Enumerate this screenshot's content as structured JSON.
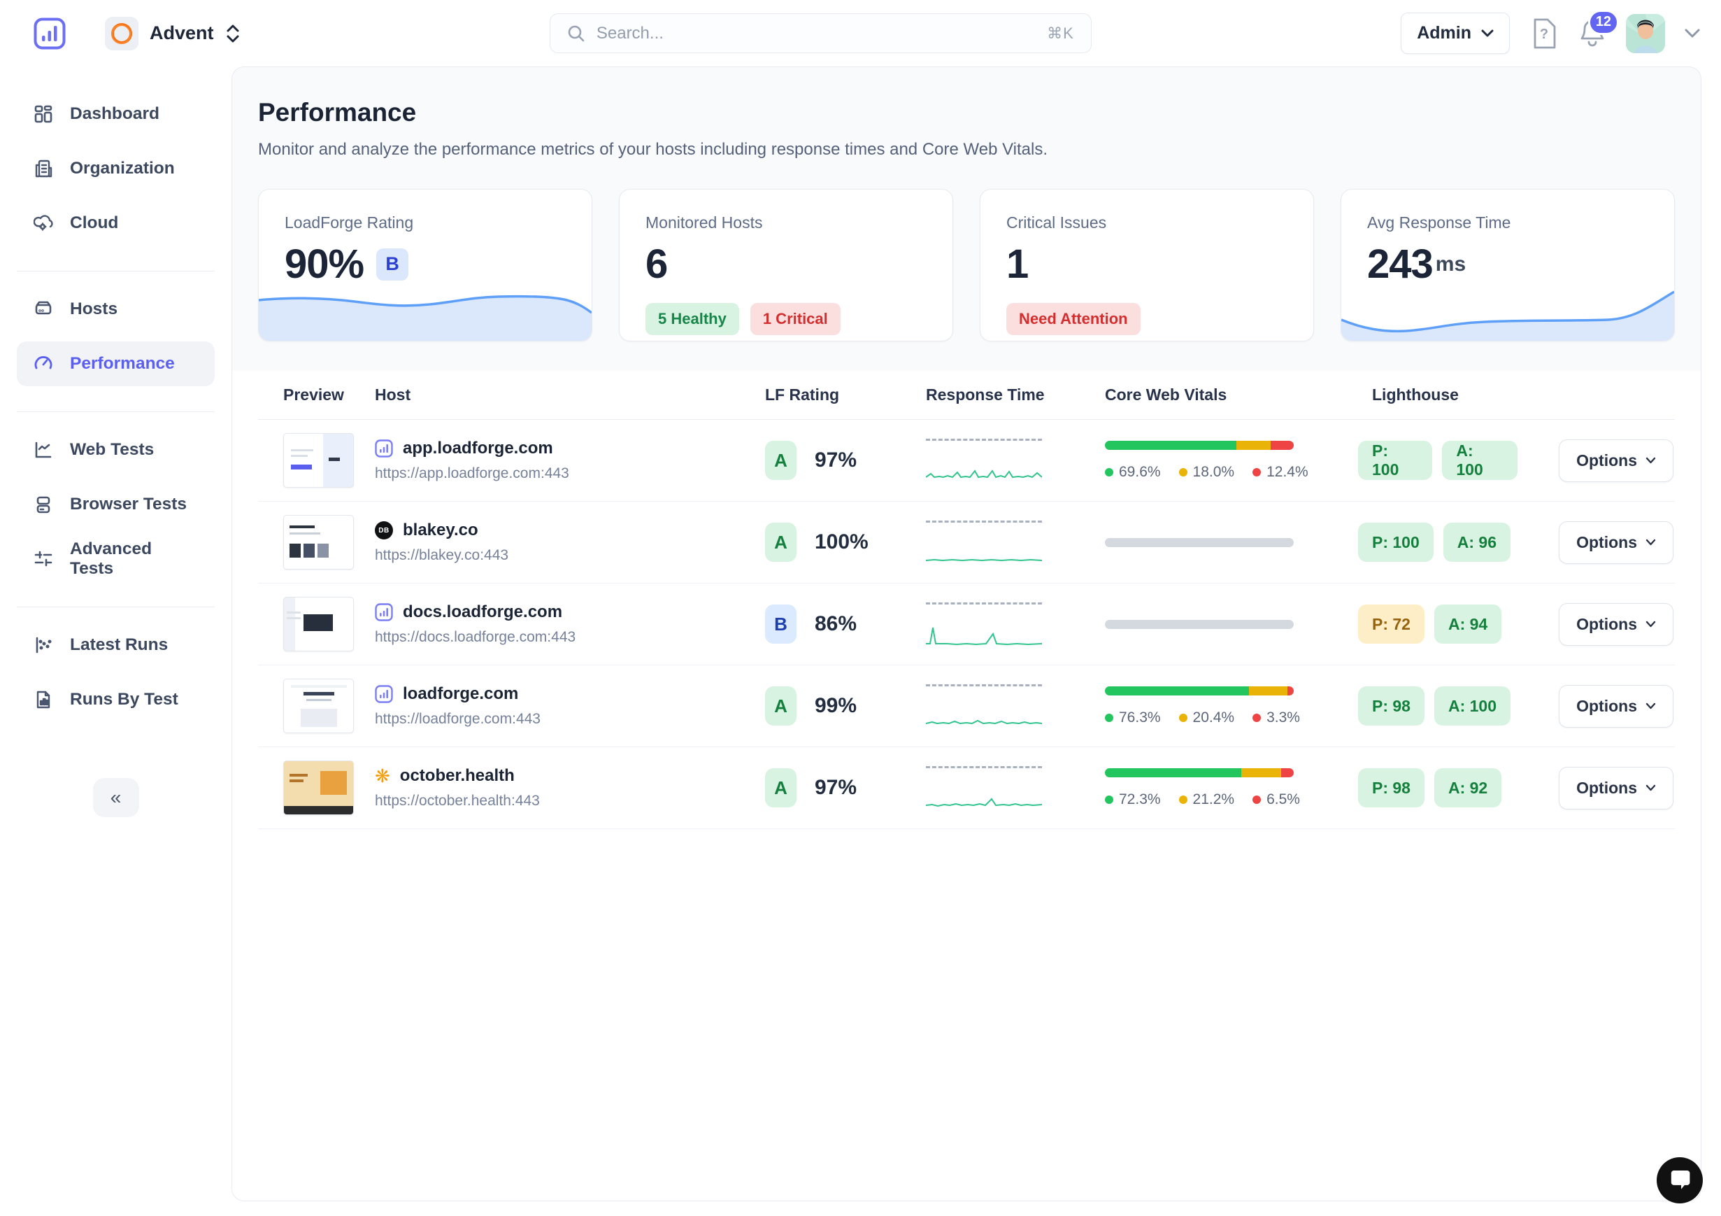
{
  "header": {
    "org": {
      "name": "Advent"
    },
    "search": {
      "placeholder": "Search...",
      "shortcut": "⌘K"
    },
    "role": {
      "label": "Admin"
    },
    "notifications": {
      "count": "12"
    },
    "icons": {
      "logo": "bar-chart",
      "search": "magnifier",
      "help": "question-file",
      "notifications": "bell",
      "org_switcher": "chevron-up-down",
      "user_menu": "chevron-down"
    }
  },
  "sidebar": {
    "sections": [
      {
        "items": [
          {
            "label": "Dashboard",
            "icon": "grid"
          },
          {
            "label": "Organization",
            "icon": "building"
          },
          {
            "label": "Cloud",
            "icon": "cloud-gear"
          }
        ]
      },
      {
        "items": [
          {
            "label": "Hosts",
            "icon": "server"
          },
          {
            "label": "Performance",
            "icon": "gauge",
            "active": true
          }
        ]
      },
      {
        "items": [
          {
            "label": "Web Tests",
            "icon": "line-chart"
          },
          {
            "label": "Browser Tests",
            "icon": "browser-stack"
          },
          {
            "label": "Advanced Tests",
            "icon": "sliders"
          }
        ]
      },
      {
        "items": [
          {
            "label": "Latest Runs",
            "icon": "scatter-chart"
          },
          {
            "label": "Runs By Test",
            "icon": "report-doc"
          }
        ]
      }
    ],
    "collapse": "«"
  },
  "page": {
    "title": "Performance",
    "subtitle": "Monitor and analyze the performance metrics of your hosts including response times and Core Web Vitals."
  },
  "stats": {
    "rating": {
      "label": "LoadForge Rating",
      "value": "90%",
      "grade": "B"
    },
    "hosts": {
      "label": "Monitored Hosts",
      "value": "6",
      "healthy": "5 Healthy",
      "critical": "1 Critical"
    },
    "issues": {
      "label": "Critical Issues",
      "value": "1",
      "badge": "Need Attention"
    },
    "response": {
      "label": "Avg Response Time",
      "value": "243",
      "unit": "ms"
    }
  },
  "table": {
    "columns": {
      "preview": "Preview",
      "host": "Host",
      "rating": "LF Rating",
      "response": "Response Time",
      "vitals": "Core Web Vitals",
      "lighthouse": "Lighthouse"
    },
    "options_label": "Options",
    "rows": [
      {
        "host": "app.loadforge.com",
        "url": "https://app.loadforge.com:443",
        "favicon": "loadforge-chart-icon",
        "grade": "A",
        "grade_tone": "green",
        "rating": "97%",
        "vitals": {
          "good": "69.6%",
          "needs_improvement": "18.0%",
          "poor": "12.4%"
        },
        "lighthouse": {
          "p": "P: 100",
          "p_tone": "green",
          "a": "A: 100",
          "a_tone": "green"
        }
      },
      {
        "host": "blakey.co",
        "url": "https://blakey.co:443",
        "favicon": "db-circle-icon",
        "favicon_text": "DB",
        "grade": "A",
        "grade_tone": "green",
        "rating": "100%",
        "vitals": null,
        "lighthouse": {
          "p": "P: 100",
          "p_tone": "green",
          "a": "A: 96",
          "a_tone": "green"
        }
      },
      {
        "host": "docs.loadforge.com",
        "url": "https://docs.loadforge.com:443",
        "favicon": "loadforge-chart-icon",
        "grade": "B",
        "grade_tone": "blue",
        "rating": "86%",
        "vitals": null,
        "lighthouse": {
          "p": "P: 72",
          "p_tone": "amber",
          "a": "A: 94",
          "a_tone": "green"
        }
      },
      {
        "host": "loadforge.com",
        "url": "https://loadforge.com:443",
        "favicon": "loadforge-chart-icon",
        "grade": "A",
        "grade_tone": "green",
        "rating": "99%",
        "vitals": {
          "good": "76.3%",
          "needs_improvement": "20.4%",
          "poor": "3.3%"
        },
        "lighthouse": {
          "p": "P: 98",
          "p_tone": "green",
          "a": "A: 100",
          "a_tone": "green"
        }
      },
      {
        "host": "october.health",
        "url": "https://october.health:443",
        "favicon": "flower-icon",
        "grade": "A",
        "grade_tone": "green",
        "rating": "97%",
        "vitals": {
          "good": "72.3%",
          "needs_improvement": "21.2%",
          "poor": "6.5%"
        },
        "lighthouse": {
          "p": "P: 98",
          "p_tone": "green",
          "a": "A: 92",
          "a_tone": "green"
        }
      }
    ]
  },
  "colors": {
    "accent": "#6366f1",
    "good": "#22c55e",
    "warn": "#eab308",
    "poor": "#ef4444",
    "spark_green": "#31c48d",
    "spark_blue": "#5e9ff8"
  }
}
